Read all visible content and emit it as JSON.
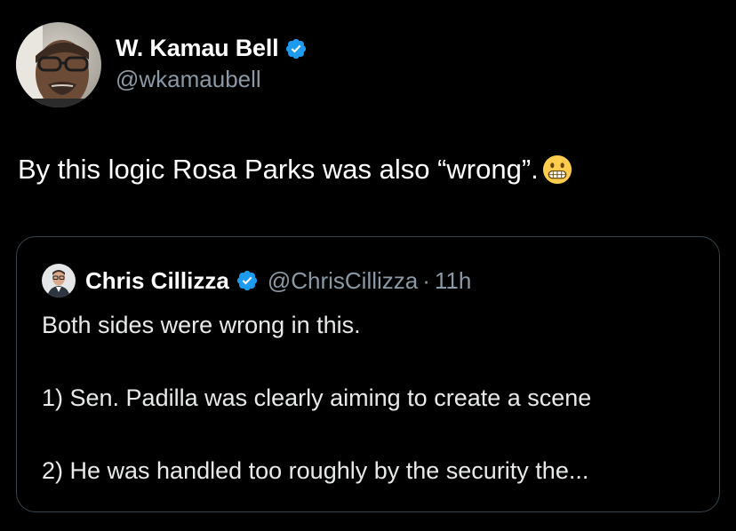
{
  "author": {
    "display_name": "W. Kamau Bell",
    "handle": "@wkamaubell",
    "verified_icon": "verified-badge-icon",
    "avatar_icon": "user-photo"
  },
  "tweet": {
    "text": "By this logic Rosa Parks was also “wrong”.",
    "emoji": "grimacing-face-icon"
  },
  "quoted_tweet": {
    "display_name": "Chris Cillizza",
    "handle": "@ChrisCillizza",
    "separator": "·",
    "time": "11h",
    "lines": [
      "Both sides were wrong in this.",
      "1) Sen. Padilla was clearly aiming to create a scene",
      "2) He was handled too roughly by the security the..."
    ]
  },
  "colors": {
    "background": "#000000",
    "text": "#e7e9ea",
    "secondary_text": "#8b98a5",
    "verified_blue": "#1d9bf0",
    "border": "#38444d"
  }
}
